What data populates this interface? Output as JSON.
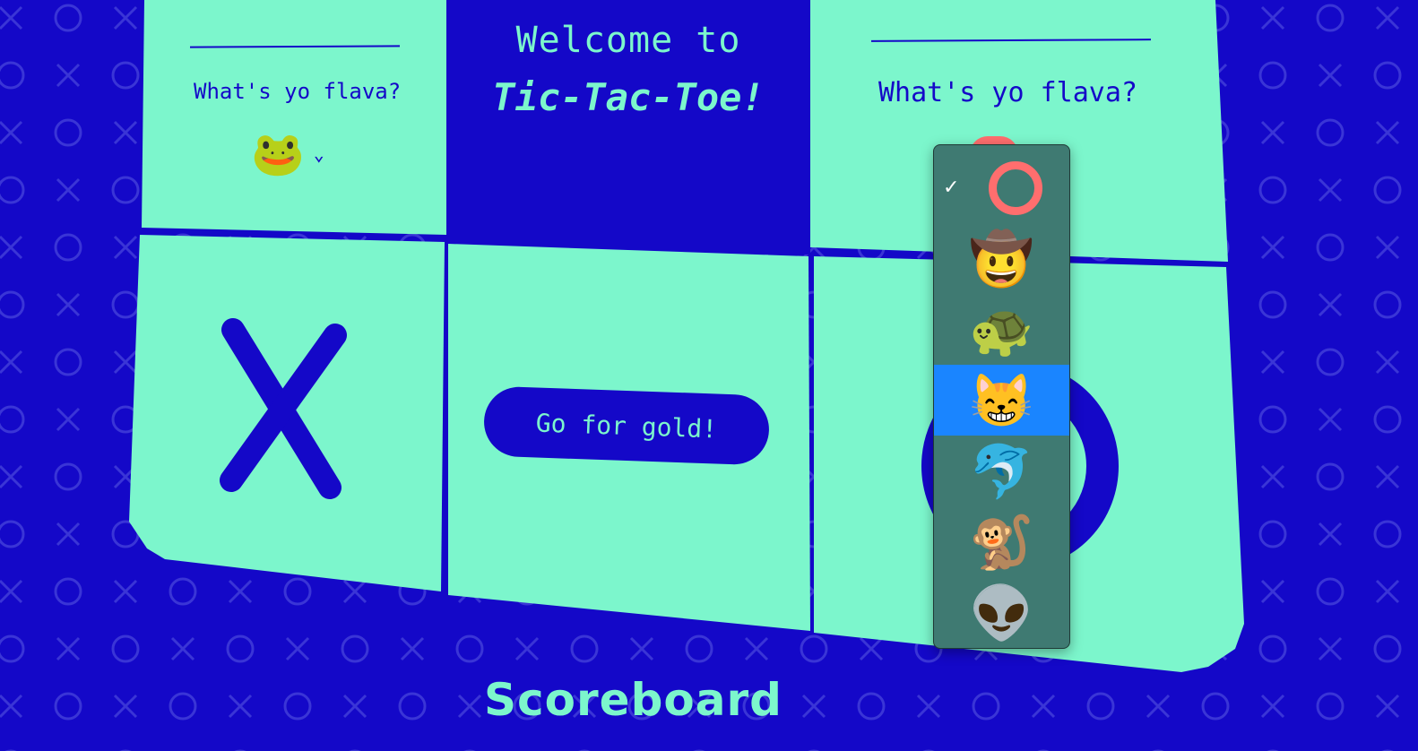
{
  "colors": {
    "background": "#1408c8",
    "board": "#7cf6cc",
    "accent_red": "#ff6e6e",
    "highlight": "#1a85ff"
  },
  "header": {
    "welcome_line": "Welcome to",
    "title": "Tic-Tac-Toe!"
  },
  "player_one": {
    "label": "What's yo flava?",
    "selected_emoji": "🐸",
    "chevron_icon": "chevron-down-icon"
  },
  "player_two": {
    "label": "What's yo flava?"
  },
  "board": {
    "marks": [
      "X",
      "O"
    ]
  },
  "action": {
    "go_label": "Go for gold!"
  },
  "scoreboard": {
    "title": "Scoreboard"
  },
  "dropdown": {
    "selected_icon": "checkmark-icon",
    "options": [
      {
        "emoji": "⭕",
        "selected": true
      },
      {
        "emoji": "🤠"
      },
      {
        "emoji": "🐢"
      },
      {
        "emoji": "😸",
        "highlighted": true
      },
      {
        "emoji": "🐬"
      },
      {
        "emoji": "🐒"
      },
      {
        "emoji": "👽"
      }
    ]
  }
}
